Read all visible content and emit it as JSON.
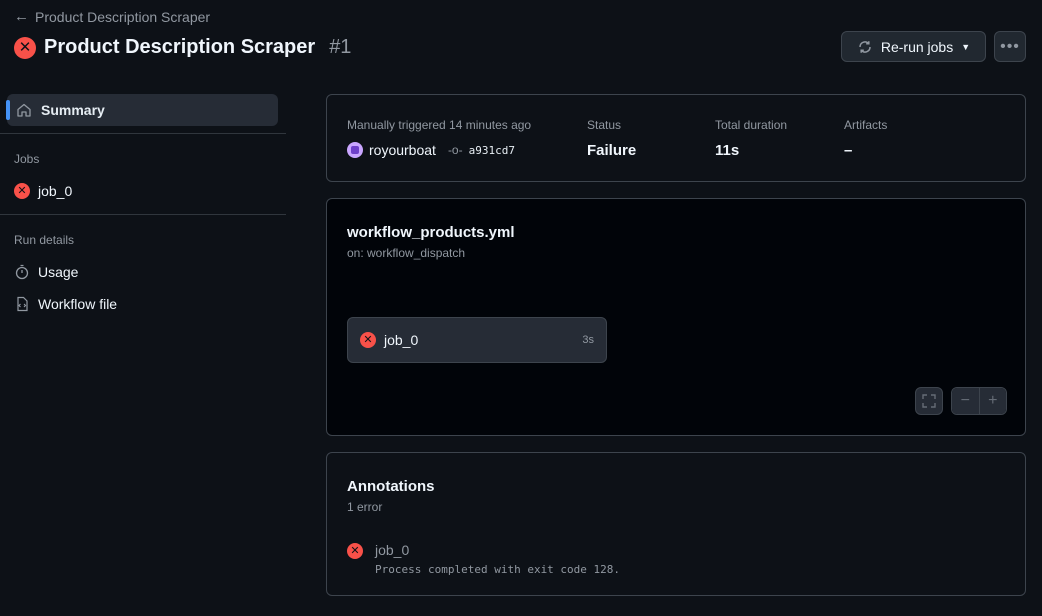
{
  "header": {
    "back_label": "Product Description Scraper",
    "title": "Product Description Scraper",
    "run_number": "#1",
    "rerun_label": "Re-run jobs"
  },
  "sidebar": {
    "summary_label": "Summary",
    "jobs_heading": "Jobs",
    "jobs": [
      {
        "label": "job_0",
        "status": "failure"
      }
    ],
    "run_details_heading": "Run details",
    "usage_label": "Usage",
    "workflow_file_label": "Workflow file"
  },
  "summary": {
    "trigger_label": "Manually triggered 14 minutes ago",
    "actor": "royourboat",
    "commit": "a931cd7",
    "status_label": "Status",
    "status_value": "Failure",
    "duration_label": "Total duration",
    "duration_value": "11s",
    "artifacts_label": "Artifacts",
    "artifacts_value": "–"
  },
  "graph": {
    "file_name": "workflow_products.yml",
    "trigger": "on: workflow_dispatch",
    "job_label": "job_0",
    "job_duration": "3s"
  },
  "annotations": {
    "title": "Annotations",
    "count_label": "1 error",
    "items": [
      {
        "job": "job_0",
        "message": "Process completed with exit code 128."
      }
    ]
  },
  "colors": {
    "background": "#0d1117",
    "error": "#f85149",
    "accent": "#4493f8",
    "border": "#3d444d"
  },
  "icons": [
    "arrow-left-icon",
    "x-circle-icon",
    "sync-icon",
    "triangle-down-icon",
    "kebab-icon",
    "home-icon",
    "stopwatch-icon",
    "file-code-icon",
    "git-commit-icon",
    "fullscreen-icon",
    "zoom-out-icon",
    "zoom-in-icon"
  ]
}
